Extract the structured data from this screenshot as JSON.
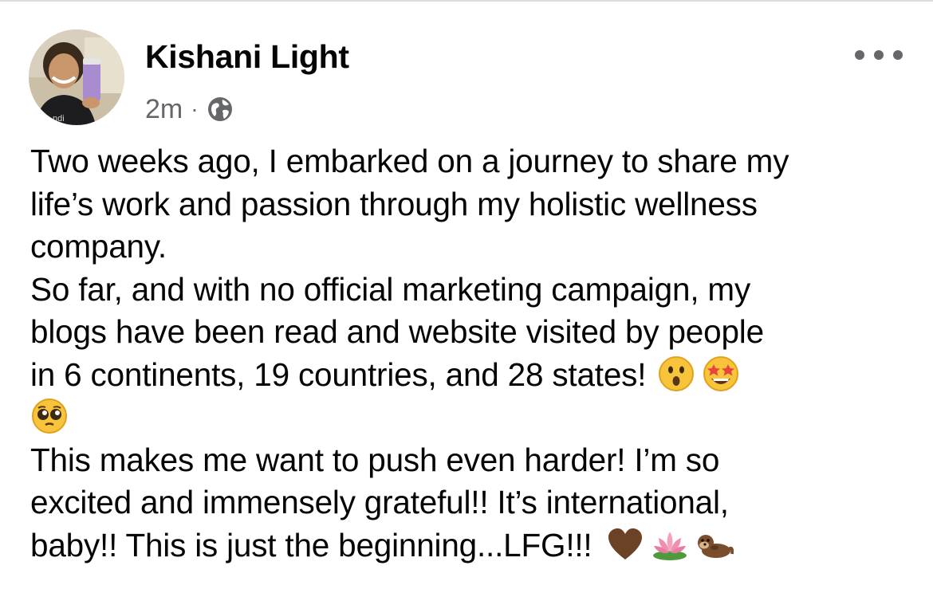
{
  "post": {
    "author": "Kishani Light",
    "timestamp": "2m",
    "separator": "·",
    "audience_icon": "globe-icon",
    "more_icon": "more-options-icon",
    "lines": [
      "Two weeks ago, I embarked on a journey to share my",
      "life’s work and passion through my holistic wellness",
      "company.",
      "So far, and with no official marketing campaign, my",
      "blogs have been read and website visited by people",
      "in 6 continents, 19 countries, and 28 states!",
      "",
      "This makes me want to push even harder! I’m so",
      "excited and immensely grateful!! It’s international,",
      "baby!! This is just the beginning...LFG!!!"
    ],
    "emojis": {
      "line6": [
        "astonished-face-emoji",
        "star-struck-emoji"
      ],
      "line7": [
        "pleading-face-emoji"
      ],
      "line10": [
        "brown-heart-emoji",
        "lotus-emoji",
        "otter-emoji"
      ]
    }
  },
  "colors": {
    "text": "#050505",
    "secondary": "#65676b",
    "brown_heart": "#6b4226"
  }
}
